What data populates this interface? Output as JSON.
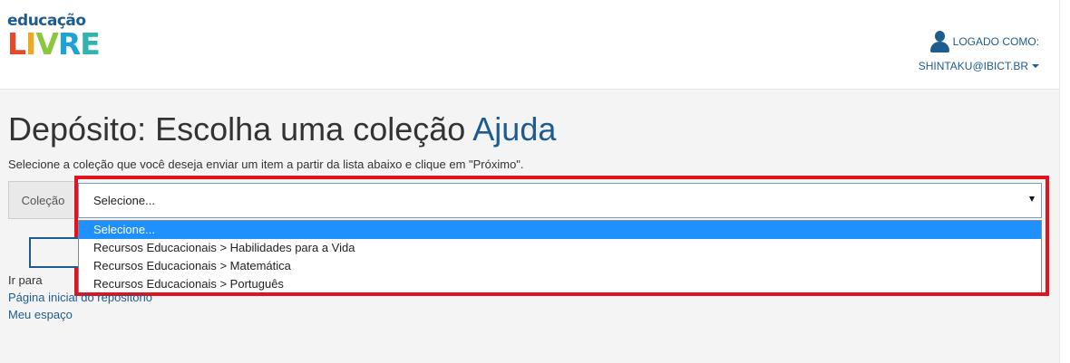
{
  "brand": {
    "logo_top": "educação",
    "logo_bottom": [
      "L",
      "I",
      "V",
      "R",
      "E"
    ]
  },
  "user": {
    "logged_label": "LOGADO COMO:",
    "email": "SHINTAKU@IBICT.BR"
  },
  "page": {
    "title": "Depósito: Escolha uma coleção",
    "help_link": "Ajuda",
    "instruction": "Selecione a coleção que você deseja enviar um item a partir da lista abaixo e clique em \"Próximo\"."
  },
  "form": {
    "collection_label": "Coleção",
    "selected_value": "Selecione...",
    "options": [
      "Selecione...",
      "Recursos Educacionais > Habilidades para a Vida",
      "Recursos Educacionais > Matemática",
      "Recursos Educacionais > Português"
    ]
  },
  "goto": {
    "label": "Ir para",
    "links": [
      "Página inicial do repositório",
      "Meu espaço"
    ]
  },
  "colors": {
    "accent": "#1e5b8f",
    "highlight_border": "#e0141e",
    "selected_option": "#1e90ff"
  }
}
